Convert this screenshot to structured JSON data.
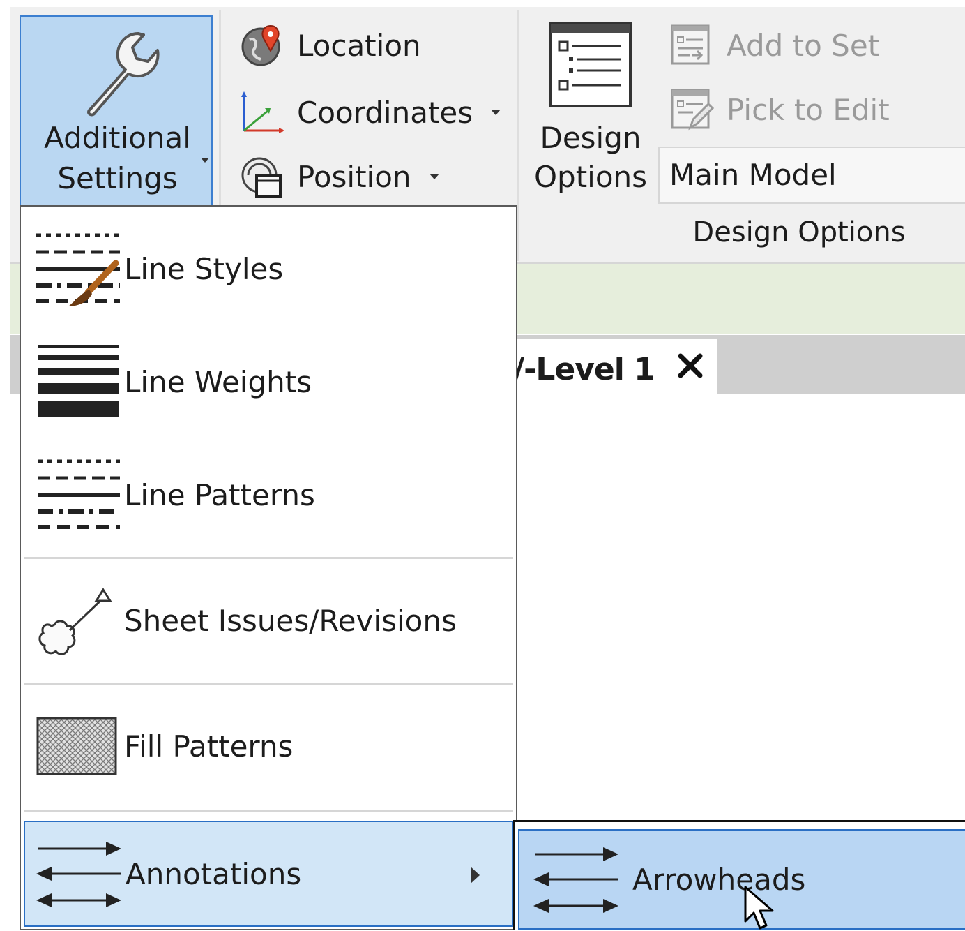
{
  "ribbon": {
    "additional_settings": {
      "line1": "Additional",
      "line2": "Settings",
      "icon": "wrench-icon"
    },
    "location_label": "Location",
    "coordinates_label": "Coordinates",
    "position_label": "Position",
    "design_options_line1": "Design",
    "design_options_line2": "Options",
    "add_to_set_label": "Add to Set",
    "pick_to_edit_label": "Pick to Edit",
    "main_model_value": "Main Model",
    "design_options_panel_label": "Design Options"
  },
  "view_tab": {
    "title": "/-Level 1",
    "close_glyph": "✕"
  },
  "dropdown": {
    "items": [
      {
        "label": "Line Styles",
        "icon": "line-styles-icon"
      },
      {
        "label": "Line Weights",
        "icon": "line-weights-icon"
      },
      {
        "label": "Line Patterns",
        "icon": "line-patterns-icon"
      },
      {
        "label": "Sheet Issues/Revisions",
        "icon": "revision-cloud-icon"
      },
      {
        "label": "Fill Patterns",
        "icon": "fill-patterns-icon"
      },
      {
        "label": "Annotations",
        "icon": "arrows-icon"
      }
    ]
  },
  "submenu": {
    "items": [
      {
        "label": "Arrowheads",
        "icon": "arrows-icon"
      }
    ]
  },
  "colors": {
    "highlight": "#b9d6f3",
    "highlight_border": "#2a6fc4",
    "ribbon_bg": "#f0f0f0",
    "status_green": "#e6eedc"
  }
}
